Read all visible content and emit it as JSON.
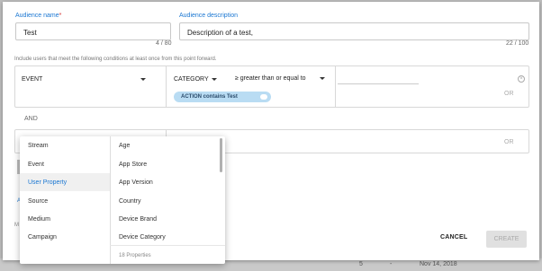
{
  "form": {
    "name_label": "Audience name",
    "name_required": "*",
    "name_value": "Test",
    "name_counter": "4 / 80",
    "desc_label": "Audience description",
    "desc_value": "Description of a test,",
    "desc_counter": "22 / 100",
    "hint": "Include users that meet the following conditions at least once from this point forward."
  },
  "condition": {
    "event_select": "EVENT",
    "category_select": "CATEGORY",
    "operator_select": "≥ greater than or equal to",
    "chip": "ACTION contains Test",
    "or_label": "OR",
    "and_label": "AND",
    "or_label_2": "OR"
  },
  "dropdown": {
    "categories": [
      "Stream",
      "Event",
      "User Property",
      "Source",
      "Medium",
      "Campaign"
    ],
    "active_category": "User Property",
    "properties": [
      "Age",
      "App Store",
      "App Version",
      "Country",
      "Device Brand",
      "Device Category"
    ],
    "count": "18 Properties"
  },
  "stubs": {
    "a": "A",
    "m": "M"
  },
  "actions": {
    "cancel": "CANCEL",
    "create": "CREATE"
  },
  "background_row": {
    "num": "5",
    "dash": "-",
    "date": "Nov 14, 2018"
  },
  "colors": {
    "accent": "#1976d2",
    "chip": "#b9dcf3"
  }
}
